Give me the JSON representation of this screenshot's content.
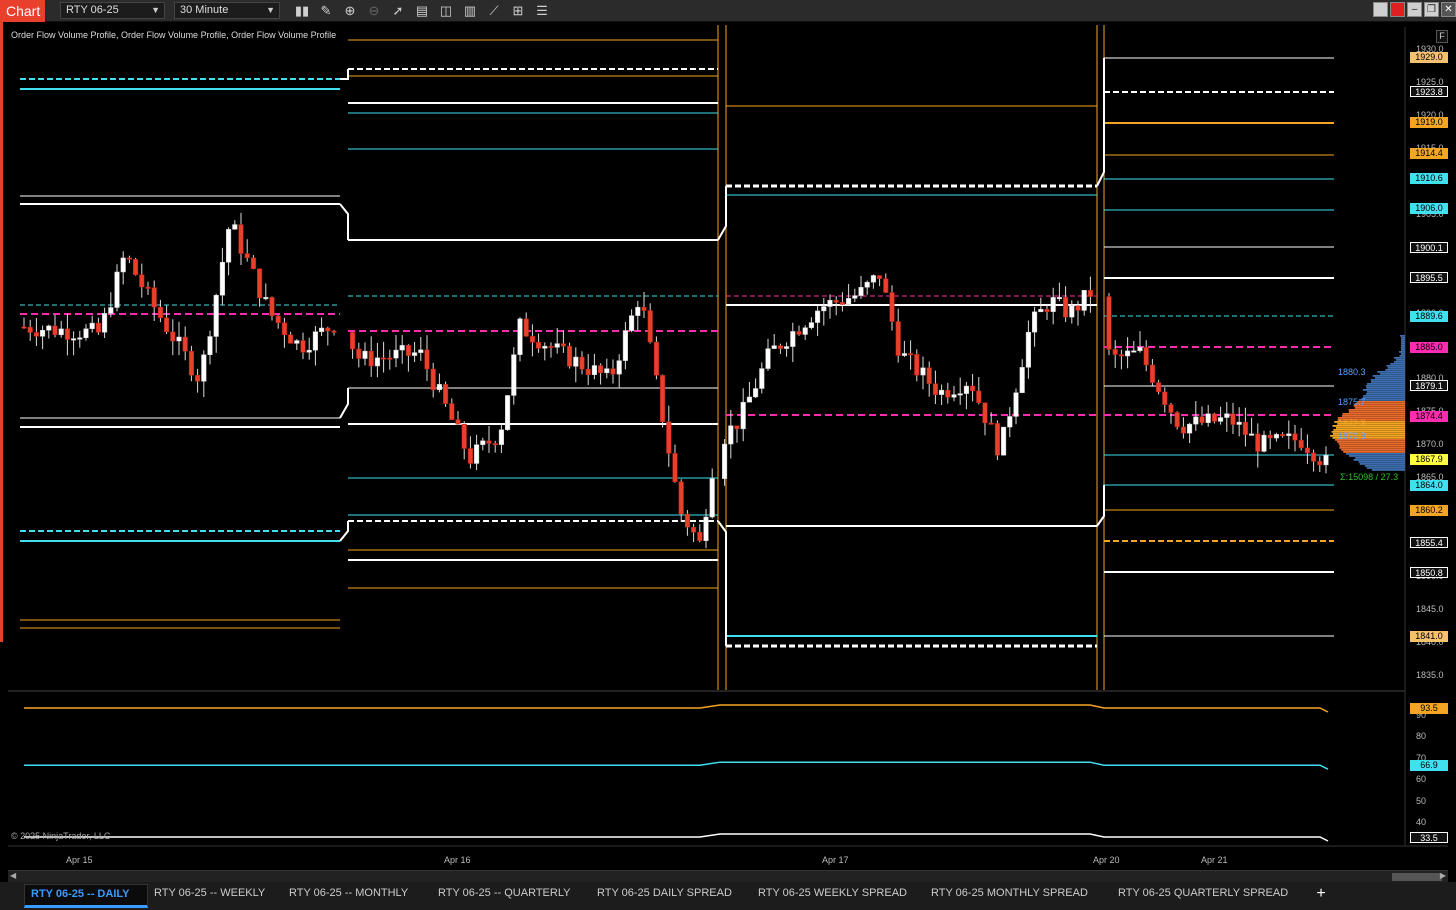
{
  "toolbar": {
    "chart_label": "Chart",
    "instrument": "RTY 06-25",
    "interval": "30 Minute",
    "icons": [
      "bar-type-icon",
      "draw-pencil-icon",
      "zoom-in-icon",
      "zoom-out-icon",
      "pointer-icon",
      "properties-icon",
      "templates-icon",
      "indicators-icon",
      "strategies-icon",
      "data-box-icon",
      "list-icon"
    ]
  },
  "indicator_label": "Order Flow Volume Profile, Order Flow Volume Profile, Order Flow Volume Profile",
  "f_button": "F",
  "price_axis": {
    "ticks": [
      "1930.0",
      "1925.0",
      "1920.0",
      "1915.0",
      "1910.0",
      "1905.0",
      "1900.0",
      "1895.0",
      "1890.0",
      "1885.0",
      "1880.0",
      "1875.0",
      "1870.0",
      "1865.0",
      "1860.0",
      "1855.0",
      "1850.0",
      "1845.0",
      "1840.0",
      "1835.0"
    ],
    "tags": [
      {
        "label": "1929.0",
        "color": "#f5c16c"
      },
      {
        "label": "1923.8",
        "color": "#ffffff"
      },
      {
        "label": "1919.0",
        "color": "#f5a524"
      },
      {
        "label": "1914.4",
        "color": "#f5a524"
      },
      {
        "label": "1910.6",
        "color": "#40e0f0"
      },
      {
        "label": "1906.0",
        "color": "#40e0f0"
      },
      {
        "label": "1900.1",
        "color": "#ffffff"
      },
      {
        "label": "1895.5",
        "color": "#ffffff"
      },
      {
        "label": "1889.6",
        "color": "#40e0f0"
      },
      {
        "label": "1885.0",
        "color": "#ff2bb0"
      },
      {
        "label": "1879.1",
        "color": "#ffffff"
      },
      {
        "label": "1874.4",
        "color": "#ff2bb0"
      },
      {
        "label": "1867.9",
        "color": "#ffff40"
      },
      {
        "label": "1864.0",
        "color": "#40e0f0"
      },
      {
        "label": "1860.2",
        "color": "#f5a524"
      },
      {
        "label": "1855.4",
        "color": "#ffffff"
      },
      {
        "label": "1850.8",
        "color": "#ffffff"
      },
      {
        "label": "1841.0",
        "color": "#f5c16c"
      }
    ]
  },
  "profile_labels": [
    {
      "text": "1880.3",
      "color": "#5aa0ff"
    },
    {
      "text": "1875.7",
      "color": "#5aa0ff"
    },
    {
      "text": "1872.3",
      "color": "#f5a524"
    },
    {
      "text": "1870.8",
      "color": "#5aa0ff"
    },
    {
      "text": "Σ:15098 / 27.3",
      "color": "#30c030"
    }
  ],
  "lower_axis": {
    "ticks": [
      "90",
      "80",
      "70",
      "60",
      "50",
      "40"
    ],
    "tags": [
      {
        "label": "93.5",
        "color": "#f5a524"
      },
      {
        "label": "66.9",
        "color": "#40e0f0"
      },
      {
        "label": "33.5",
        "color": "#ffffff"
      }
    ]
  },
  "time_axis": [
    "Apr 15",
    "Apr 16",
    "Apr 17",
    "Apr 20",
    "Apr 21"
  ],
  "copyright": "© 2025 NinjaTrader, LLC",
  "tabs": [
    {
      "label": "RTY 06-25 -- DAILY",
      "active": true
    },
    {
      "label": "RTY 06-25 -- WEEKLY",
      "active": false
    },
    {
      "label": "RTY 06-25 -- MONTHLY",
      "active": false
    },
    {
      "label": "RTY 06-25 -- QUARTERLY",
      "active": false
    },
    {
      "label": "RTY 06-25 DAILY SPREAD",
      "active": false
    },
    {
      "label": "RTY 06-25 WEEKLY SPREAD",
      "active": false
    },
    {
      "label": "RTY 06-25 MONTHLY SPREAD",
      "active": false
    },
    {
      "label": "RTY 06-25 QUARTERLY SPREAD",
      "active": false
    }
  ],
  "add_tab": "+",
  "colors": {
    "orange": "#f5a524",
    "cyan": "#40e0f0",
    "white": "#ffffff",
    "magenta": "#ff2bb0",
    "up": "#ffffff",
    "down": "#e8402d"
  }
}
